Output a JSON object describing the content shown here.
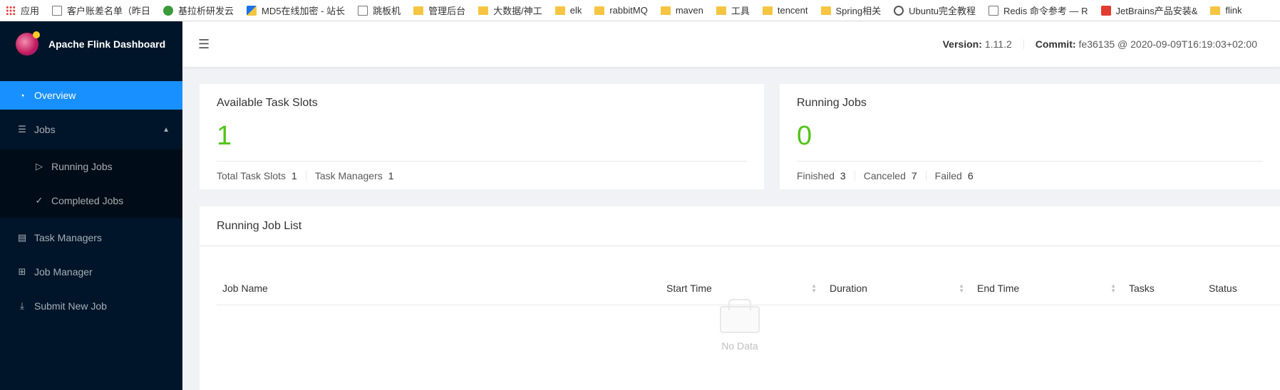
{
  "bookmarks": [
    {
      "label": "应用",
      "icon": "apps-grid-icon",
      "kind": "grid"
    },
    {
      "label": "客户账差名单（昨日",
      "icon": "page-icon",
      "kind": "page"
    },
    {
      "label": "基拉析研发云",
      "icon": "cloud-icon",
      "kind": "green"
    },
    {
      "label": "MD5在线加密 - 站长",
      "icon": "md5-icon",
      "kind": "md5"
    },
    {
      "label": "跳板机",
      "icon": "page-icon",
      "kind": "page"
    },
    {
      "label": "管理后台",
      "icon": "folder-icon",
      "kind": "folder"
    },
    {
      "label": "大数据/神工",
      "icon": "folder-icon",
      "kind": "folder"
    },
    {
      "label": "elk",
      "icon": "folder-icon",
      "kind": "folder"
    },
    {
      "label": "rabbitMQ",
      "icon": "folder-icon",
      "kind": "folder"
    },
    {
      "label": "maven",
      "icon": "folder-icon",
      "kind": "folder"
    },
    {
      "label": "工具",
      "icon": "folder-icon",
      "kind": "folder"
    },
    {
      "label": "tencent",
      "icon": "folder-icon",
      "kind": "folder"
    },
    {
      "label": "Spring相关",
      "icon": "folder-icon",
      "kind": "folder"
    },
    {
      "label": "Ubuntu完全教程",
      "icon": "ubuntu-icon",
      "kind": "ubuntu"
    },
    {
      "label": "Redis 命令参考 — R",
      "icon": "page-icon",
      "kind": "page"
    },
    {
      "label": "JetBrains产品安装&",
      "icon": "jetbrains-icon",
      "kind": "jb"
    },
    {
      "label": "flink",
      "icon": "folder-icon",
      "kind": "folder"
    }
  ],
  "sidebar": {
    "title": "Apache Flink Dashboard",
    "overview": "Overview",
    "jobs": "Jobs",
    "running_jobs": "Running Jobs",
    "completed_jobs": "Completed Jobs",
    "task_managers": "Task Managers",
    "job_manager": "Job Manager",
    "submit_new_job": "Submit New Job"
  },
  "header": {
    "version_label": "Version:",
    "version": "1.11.2",
    "commit_label": "Commit:",
    "commit": "fe36135 @ 2020-09-09T16:19:03+02:00"
  },
  "slots": {
    "title": "Available Task Slots",
    "value": "1",
    "total_label": "Total Task Slots",
    "total": "1",
    "tm_label": "Task Managers",
    "tm": "1"
  },
  "running": {
    "title": "Running Jobs",
    "value": "0",
    "finished_label": "Finished",
    "finished": "3",
    "canceled_label": "Canceled",
    "canceled": "7",
    "failed_label": "Failed",
    "failed": "6"
  },
  "joblist": {
    "title": "Running Job List",
    "columns": [
      "Job Name",
      "Start Time",
      "Duration",
      "End Time",
      "Tasks",
      "Status"
    ],
    "empty": "No Data"
  },
  "colors": {
    "sidebar_bg": "#001529",
    "active": "#1890ff",
    "success": "#52c41a"
  }
}
